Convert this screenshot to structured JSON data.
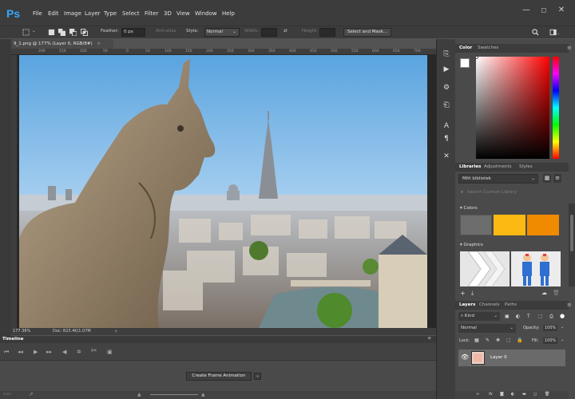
{
  "menubar": {
    "logo": "Ps",
    "items": [
      "File",
      "Edit",
      "Image",
      "Layer",
      "Type",
      "Select",
      "Filter",
      "3D",
      "View",
      "Window",
      "Help"
    ],
    "window_controls": [
      "—",
      "◻",
      "✕"
    ]
  },
  "options_bar": {
    "feather_label": "Feather:",
    "feather_value": "0 px",
    "antialias_label": "Anti-alias",
    "style_label": "Style:",
    "style_value": "Normal",
    "width_label": "Width:",
    "height_label": "Height:",
    "select_mask_label": "Select and Mask..."
  },
  "document": {
    "tab_label": "9_1.png @ 177% (Layer 0, RGB/8#)",
    "tab_close": "×",
    "ruler_ticks": [
      "200",
      "150",
      "100",
      "50",
      "0",
      "50",
      "100",
      "150",
      "200",
      "250",
      "300",
      "350",
      "400",
      "450",
      "500",
      "550",
      "600",
      "650",
      "700"
    ],
    "status_zoom": "177.36%",
    "status_doc": "Doc: 823.4K/1.07M"
  },
  "timeline": {
    "title": "Timeline",
    "create_button": "Create Frame Animation"
  },
  "color_panel": {
    "tabs": [
      "Color",
      "Swatches"
    ]
  },
  "libraries_panel": {
    "tabs": [
      "Libraries",
      "Adjustments",
      "Styles"
    ],
    "library_name": "Mitt bibliotek",
    "search_placeholder": "Search Current Library",
    "colors_label": "Colors",
    "graphics_label": "Graphics",
    "colors": [
      "#6d6d6d",
      "#fdb913",
      "#f08a00"
    ]
  },
  "layers_panel": {
    "tabs": [
      "Layers",
      "Channels",
      "Paths"
    ],
    "kind_label": "Kind",
    "blend_mode": "Normal",
    "opacity_label": "Opacity:",
    "opacity_value": "100%",
    "lock_label": "Lock:",
    "fill_label": "Fill:",
    "fill_value": "100%",
    "layers": [
      {
        "name": "Layer 0"
      }
    ]
  },
  "colors": {
    "accent": "#31a8ff",
    "panel_bg": "#4a4a4a",
    "toolbar_bg": "#3c3c3c"
  }
}
